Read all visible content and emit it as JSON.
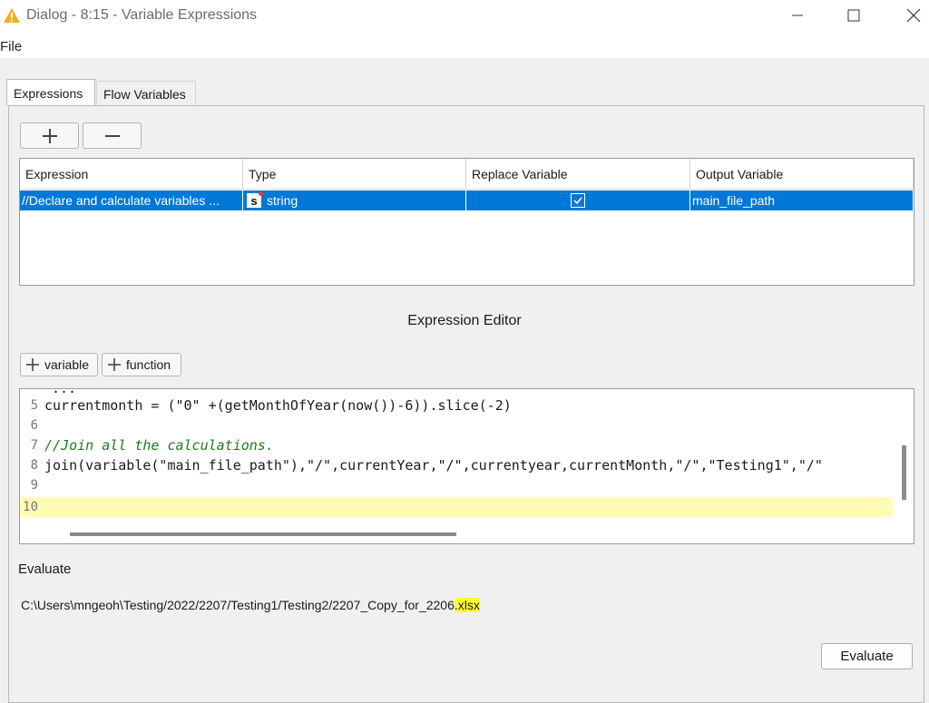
{
  "window": {
    "title": "Dialog - 8:15 - Variable Expressions"
  },
  "menu": {
    "file": "File"
  },
  "tabs": [
    {
      "label": "Expressions",
      "active": true
    },
    {
      "label": "Flow Variables",
      "active": false
    }
  ],
  "toolbar": {
    "add_symbol": "+",
    "remove_symbol": "−"
  },
  "table": {
    "headers": [
      "Expression",
      "Type",
      "Replace Variable",
      "Output Variable"
    ],
    "rows": [
      {
        "expression": "//Declare and calculate variables ...",
        "type": "string",
        "type_icon": "s",
        "replace_variable": true,
        "output_variable": "main_file_path",
        "selected": true
      }
    ]
  },
  "editor": {
    "title": "Expression Editor",
    "variable_button": "variable",
    "function_button": "function",
    "partial_top_line": "...",
    "lines": [
      {
        "num": "5",
        "code": "currentmonth = (\"0\" +(getMonthOfYear(now())-6)).slice(-2)"
      },
      {
        "num": "6",
        "code": ""
      },
      {
        "num": "7",
        "code": "//Join all the calculations."
      },
      {
        "num": "8",
        "code": "join(variable(\"main_file_path\"),\"/\",currentYear,\"/\",currentyear,currentMonth,\"/\",\"Testing1\",\"/\""
      },
      {
        "num": "9",
        "code": ""
      },
      {
        "num": "10",
        "code": ""
      }
    ]
  },
  "evaluate": {
    "label": "Evaluate",
    "result_main": "C:\\Users\\mngeoh\\Testing/2022/2207/Testing1/Testing2/2207_Copy_for_2206",
    "result_ext": ".xlsx",
    "button": "Evaluate"
  },
  "colors": {
    "selection": "#0078d7",
    "line_highlight": "#fffbb5",
    "result_highlight": "#ffff33",
    "warning_icon": "#f2b01e"
  }
}
